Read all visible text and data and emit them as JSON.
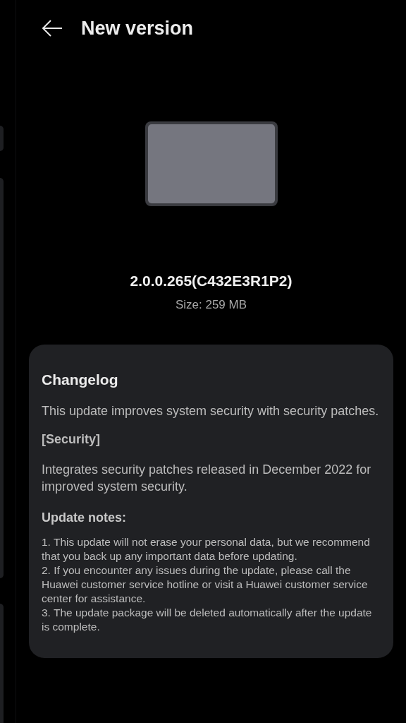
{
  "header": {
    "title": "New version"
  },
  "version": {
    "number": "2.0.0.265(C432E3R1P2)",
    "size": "Size: 259 MB"
  },
  "changelog": {
    "title": "Changelog",
    "summary": "This update improves system security with security patches.",
    "section_title": "[Security]",
    "section_text": "Integrates security patches released in December 2022 for improved system security.",
    "notes_title": "Update notes:",
    "notes": [
      "1. This update will not erase your personal data, but we recommend that you back up any important data before updating.",
      "2. If you encounter any issues during the update, please call the Huawei customer service hotline or visit a Huawei customer service center for assistance.",
      "3. The update package will be deleted automatically after the update is complete."
    ]
  }
}
